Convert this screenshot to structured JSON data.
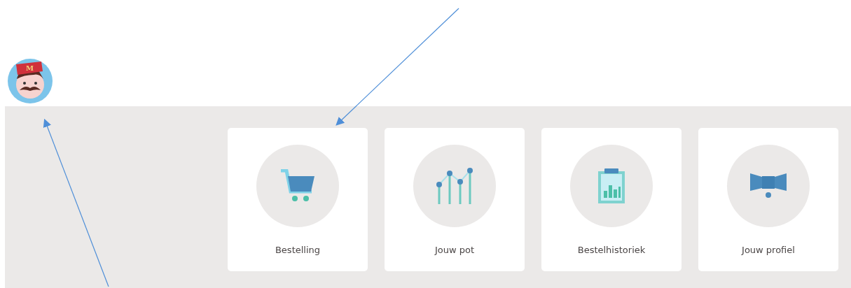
{
  "mascot": {
    "hat_letter": "M"
  },
  "tiles": [
    {
      "kind": "cart",
      "label": "Bestelling"
    },
    {
      "kind": "chart",
      "label": "Jouw pot"
    },
    {
      "kind": "clipboard",
      "label": "Bestelhistoriek"
    },
    {
      "kind": "bowtie",
      "label": "Jouw profiel"
    }
  ]
}
